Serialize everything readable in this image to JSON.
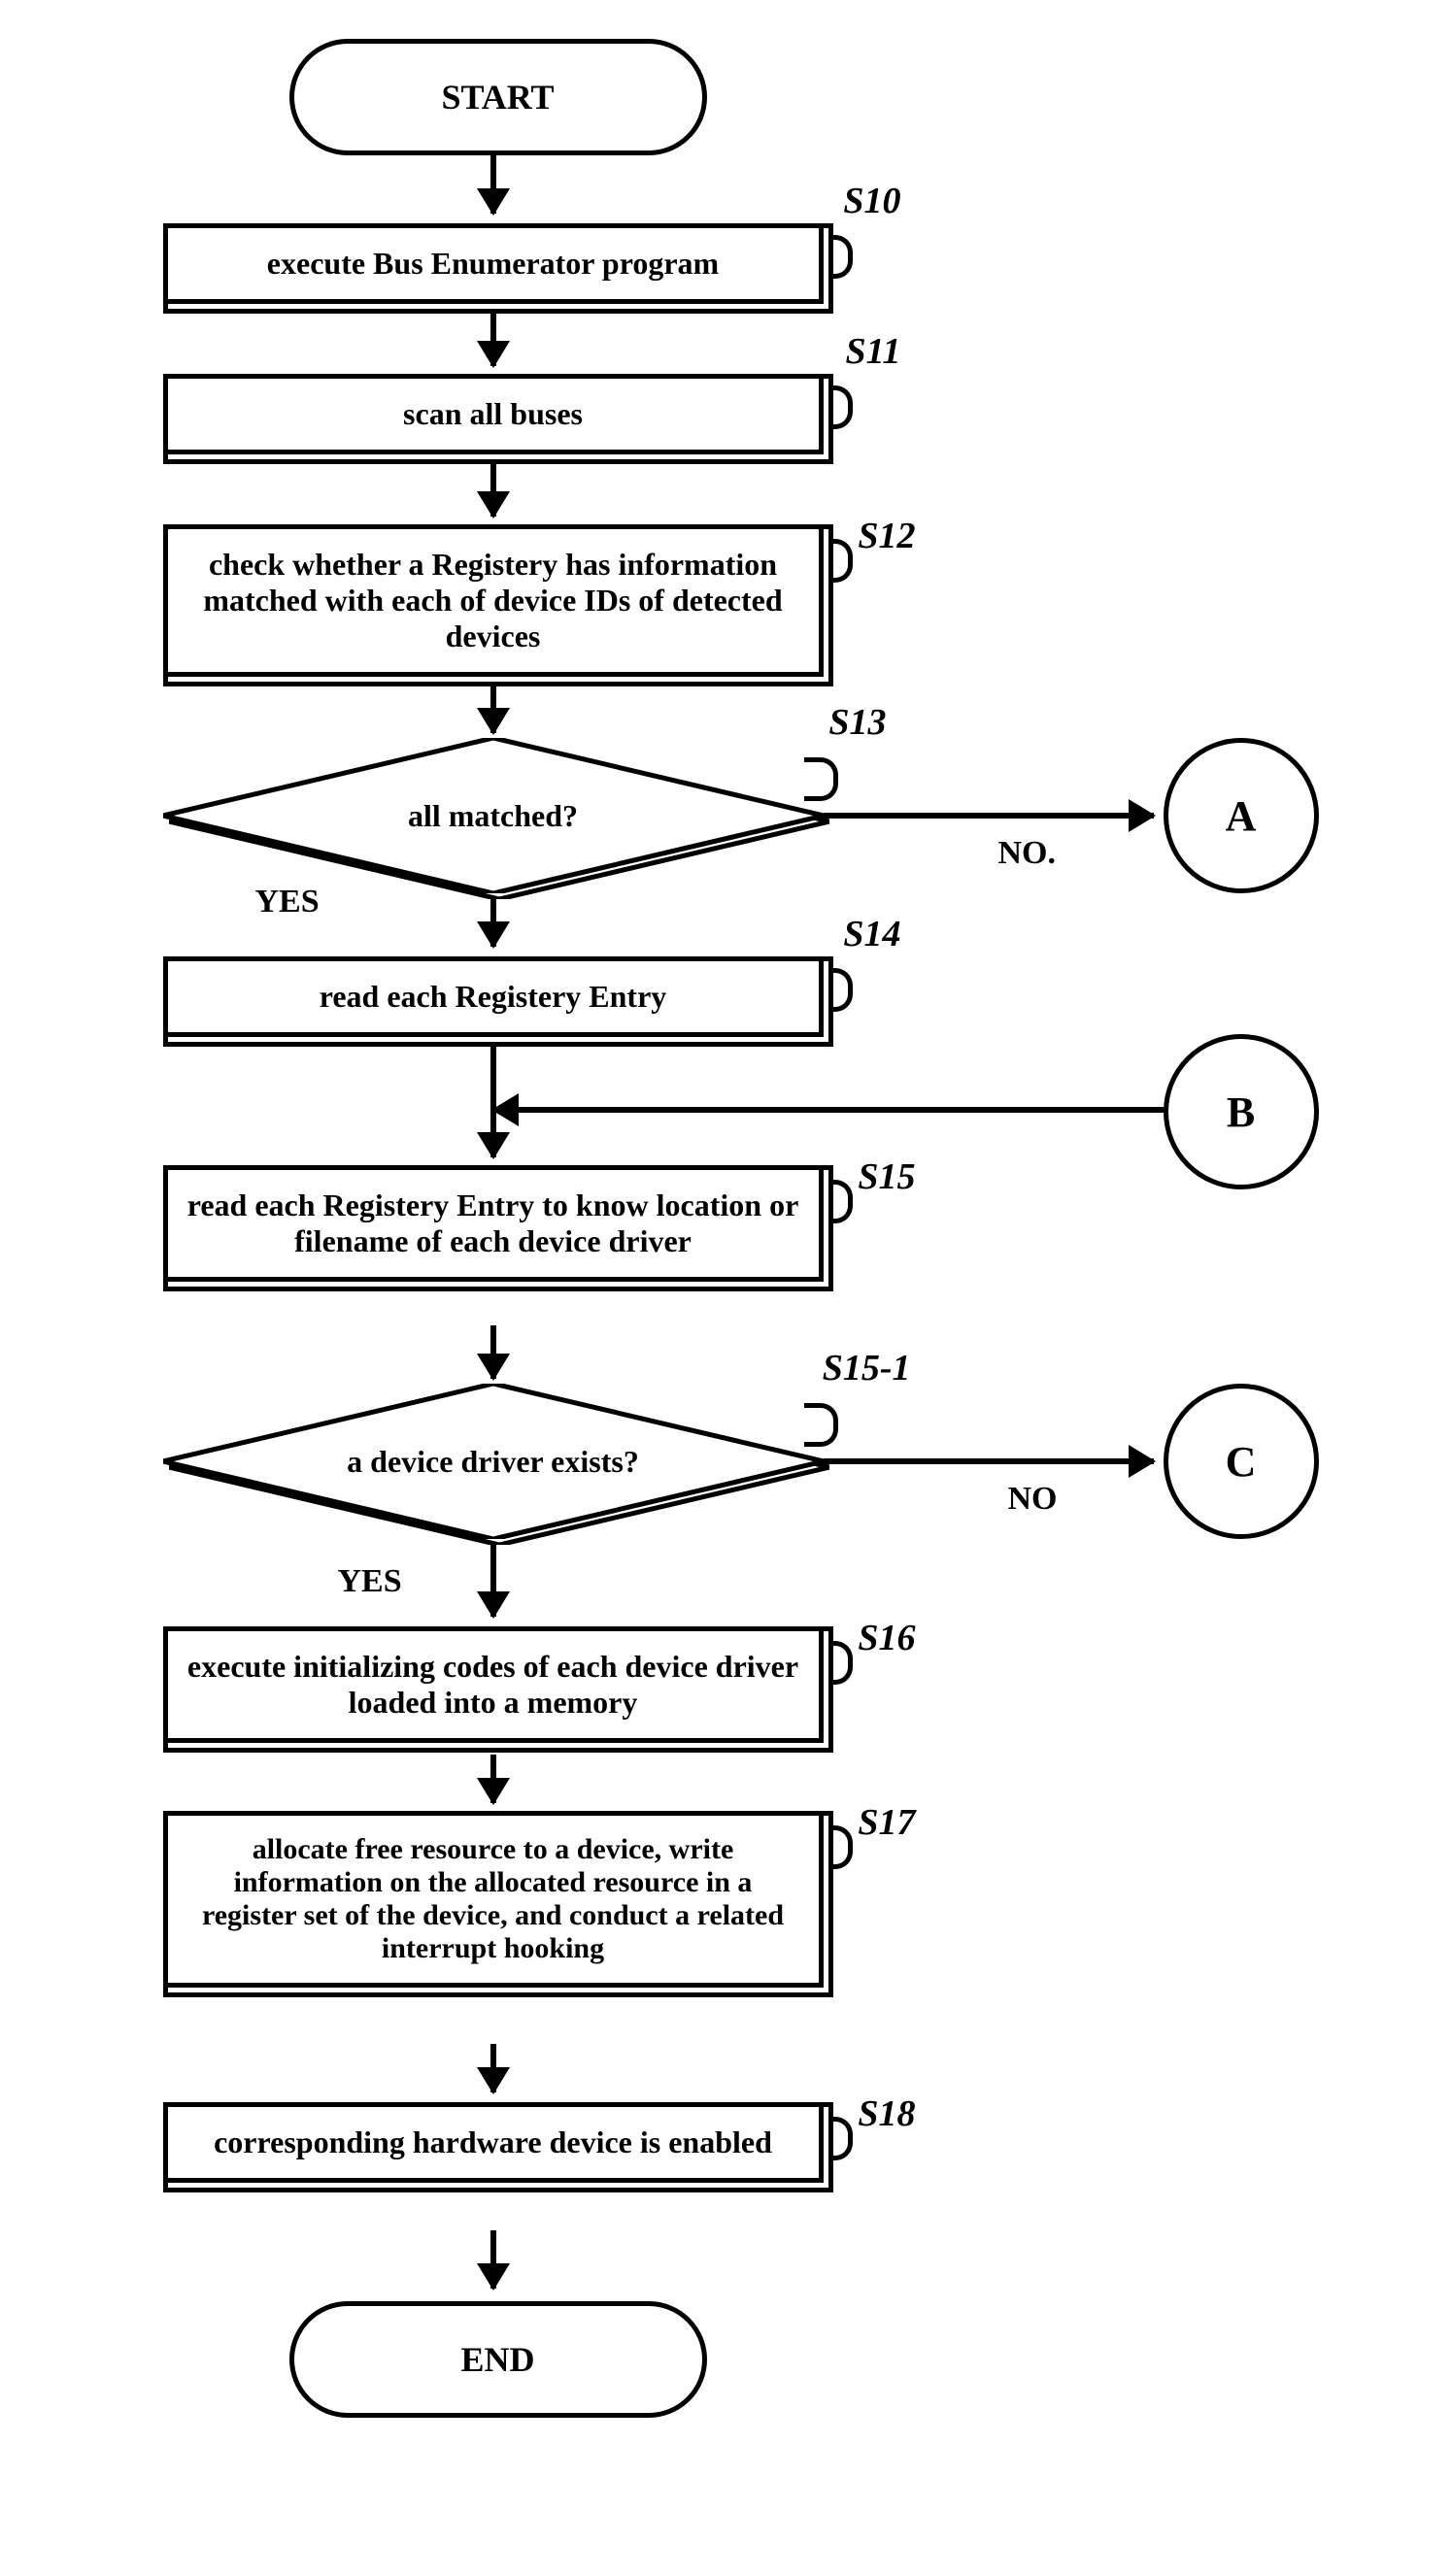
{
  "terminator": {
    "start": "START",
    "end": "END"
  },
  "steps": {
    "s10": "execute Bus Enumerator program",
    "s11": "scan all buses",
    "s12": "check whether a Registery has information matched with each of device IDs  of detected devices",
    "s13": "all matched?",
    "s14": "read each Registery Entry",
    "s15": "read each Registery Entry to know location or filename of each device driver",
    "s15_1": "a device driver exists?",
    "s16": "execute initializing codes of each device driver loaded into a memory",
    "s17": "allocate free resource to a device, write information on the allocated resource in a register set of the device, and conduct a related interrupt hooking",
    "s18": "corresponding hardware device is enabled"
  },
  "labels": {
    "s10": "S10",
    "s11": "S11",
    "s12": "S12",
    "s13": "S13",
    "s14": "S14",
    "s15": "S15",
    "s15_1": "S15-1",
    "s16": "S16",
    "s17": "S17",
    "s18": "S18"
  },
  "edges": {
    "yes": "YES",
    "no": "NO",
    "no_dot": "NO."
  },
  "connectors": {
    "a": "A",
    "b": "B",
    "c": "C"
  }
}
